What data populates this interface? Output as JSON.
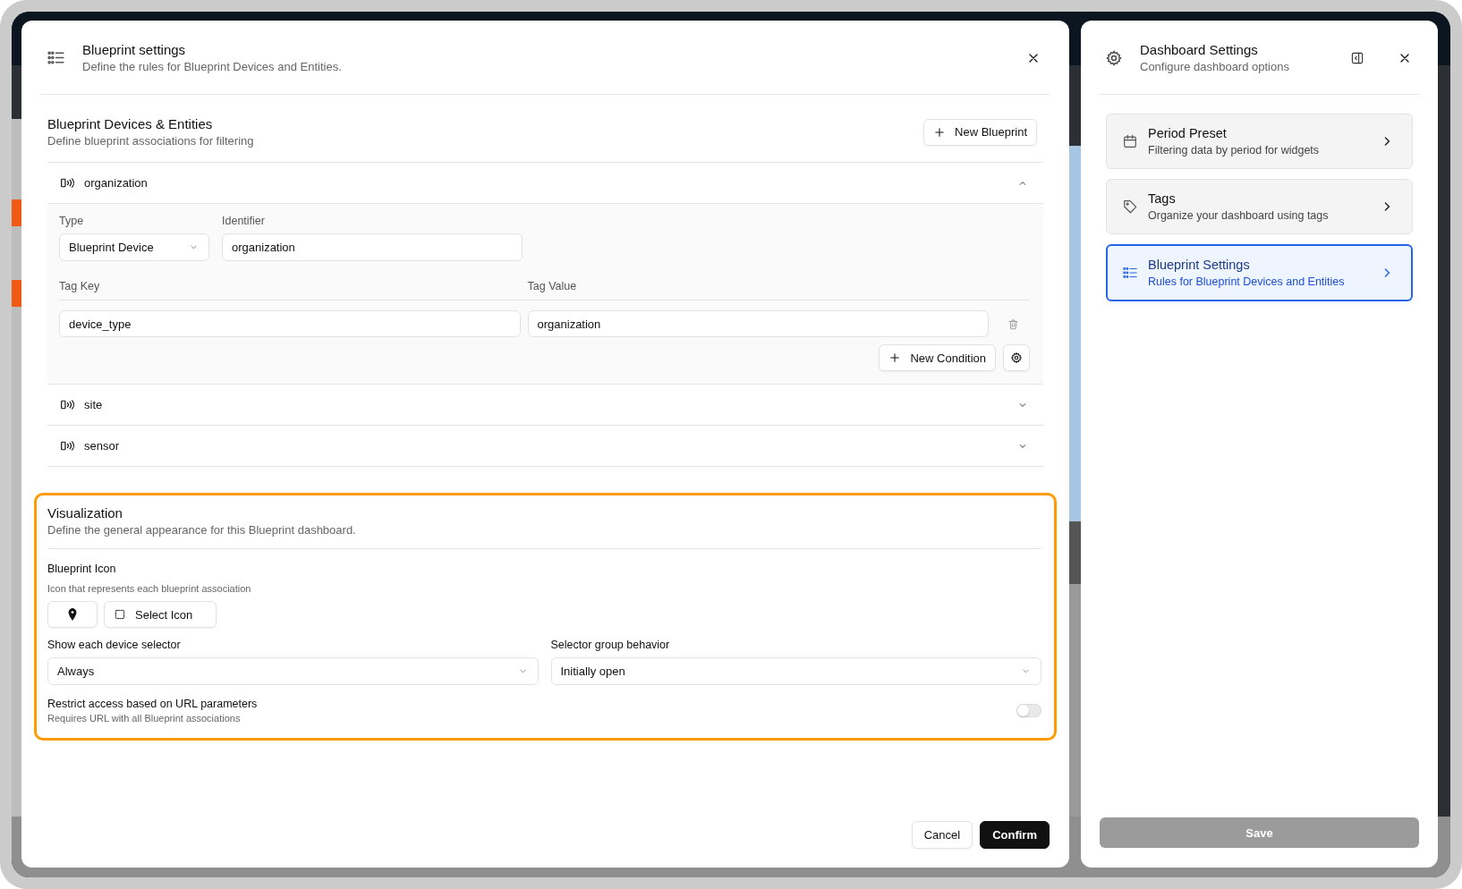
{
  "blueprint_dialog": {
    "title": "Blueprint settings",
    "subtitle": "Define the rules for Blueprint Devices and Entities.",
    "devices_section": {
      "title": "Blueprint Devices & Entities",
      "subtitle": "Define blueprint associations for filtering",
      "new_button": "New Blueprint",
      "blueprints": [
        {
          "name": "organization",
          "expanded": true,
          "type_label": "Type",
          "type_value": "Blueprint Device",
          "identifier_label": "Identifier",
          "identifier_value": "organization",
          "tag_key_label": "Tag Key",
          "tag_value_label": "Tag Value",
          "conditions": [
            {
              "key": "device_type",
              "value": "organization"
            }
          ],
          "new_condition_button": "New Condition"
        },
        {
          "name": "site",
          "expanded": false
        },
        {
          "name": "sensor",
          "expanded": false
        }
      ]
    },
    "visualization": {
      "highlighted": true,
      "title": "Visualization",
      "subtitle": "Define the general appearance for this Blueprint dashboard.",
      "icon_label": "Blueprint Icon",
      "icon_hint": "Icon that represents each blueprint association",
      "select_icon_button": "Select Icon",
      "device_selector_label": "Show each device selector",
      "device_selector_value": "Always",
      "group_behavior_label": "Selector group behavior",
      "group_behavior_value": "Initially open",
      "restrict_label": "Restrict access based on URL parameters",
      "restrict_hint": "Requires URL with all Blueprint associations",
      "restrict_on": false
    },
    "buttons": [
      {
        "label": "Cancel",
        "kind": "secondary"
      },
      {
        "label": "Confirm",
        "kind": "primary"
      }
    ]
  },
  "dashboard_settings": {
    "title": "Dashboard Settings",
    "subtitle": "Configure dashboard options",
    "items": [
      {
        "kind": "calendar",
        "title": "Period Preset",
        "subtitle": "Filtering data by period for widgets",
        "selected": false
      },
      {
        "kind": "tag",
        "title": "Tags",
        "subtitle": "Organize your dashboard using tags",
        "selected": false
      },
      {
        "kind": "list",
        "title": "Blueprint Settings",
        "subtitle": "Rules for Blueprint Devices and Entities",
        "selected": true
      }
    ],
    "save_button": {
      "label": "Save",
      "disabled": true
    }
  }
}
